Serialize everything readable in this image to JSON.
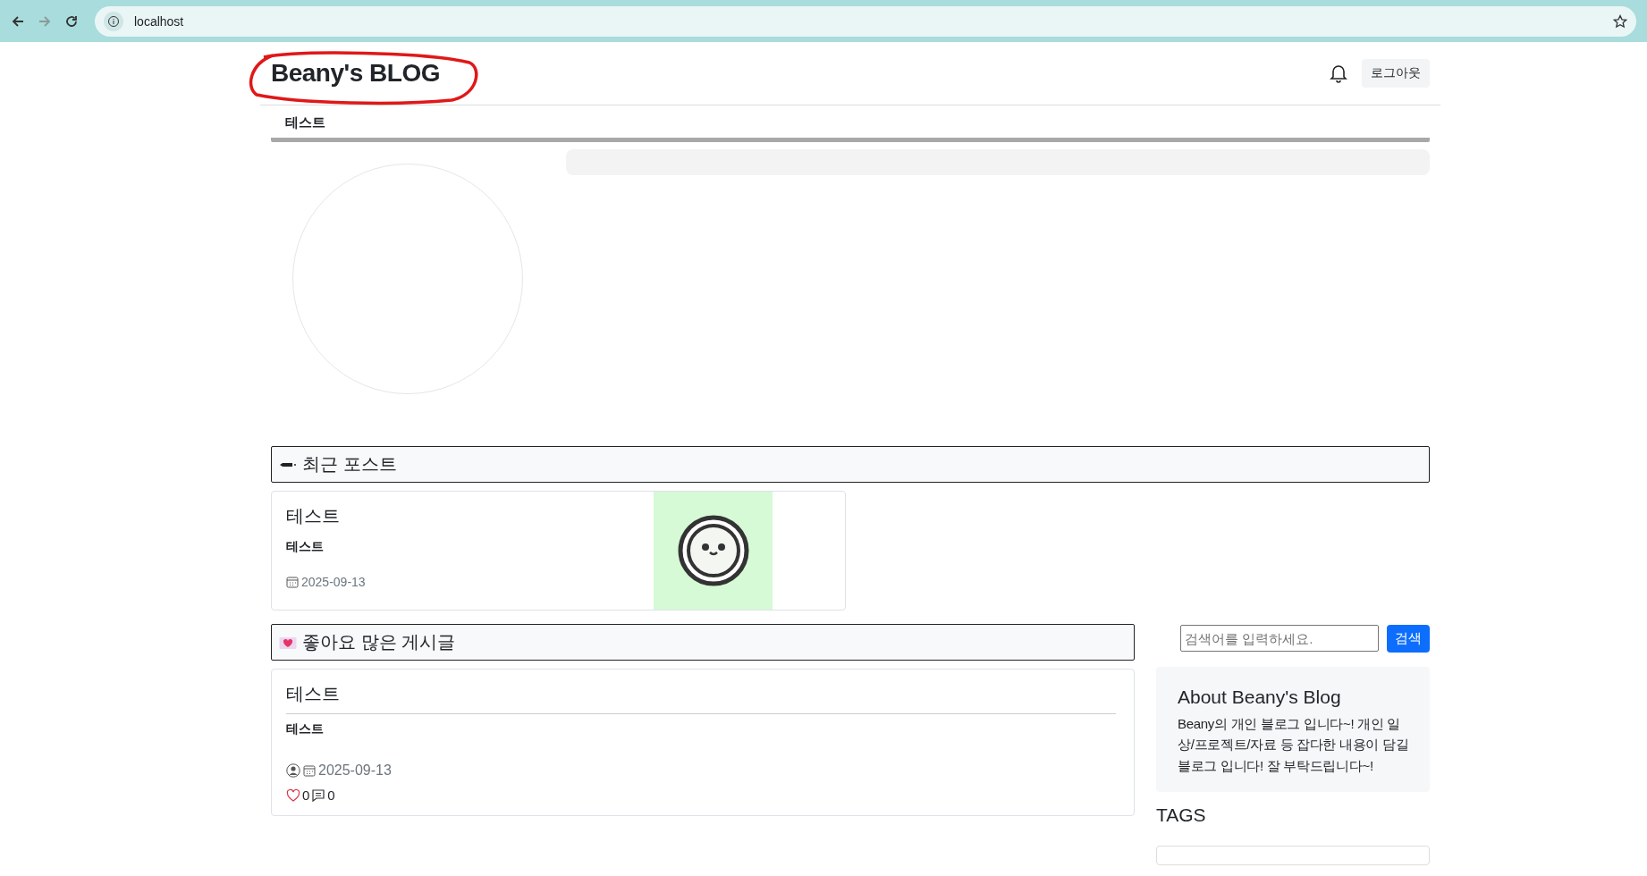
{
  "browser": {
    "url": "localhost"
  },
  "header": {
    "title": "Beany's BLOG",
    "logout": "로그아웃"
  },
  "nav": [
    {
      "label": "테스트"
    }
  ],
  "recent": {
    "heading": "최근 포스트",
    "posts": [
      {
        "title": "테스트",
        "summary": "테스트",
        "date": "2025-09-13"
      }
    ]
  },
  "popular": {
    "heading": "좋아요 많은 게시글",
    "posts": [
      {
        "title": "테스트",
        "summary": "테스트",
        "date": "2025-09-13",
        "likes": "0",
        "comments": "0"
      }
    ]
  },
  "sidebar": {
    "search": {
      "placeholder": "검색어를 입력하세요.",
      "button": "검색"
    },
    "about": {
      "title": "About Beany's Blog",
      "text": "Beany의 개인 블로그 입니다~! 개인 일상/프로젝트/자료 등 잡다한 내용이 담길 블로그 입니다! 잘 부탁드립니다~!"
    },
    "tags_heading": "TAGS"
  }
}
